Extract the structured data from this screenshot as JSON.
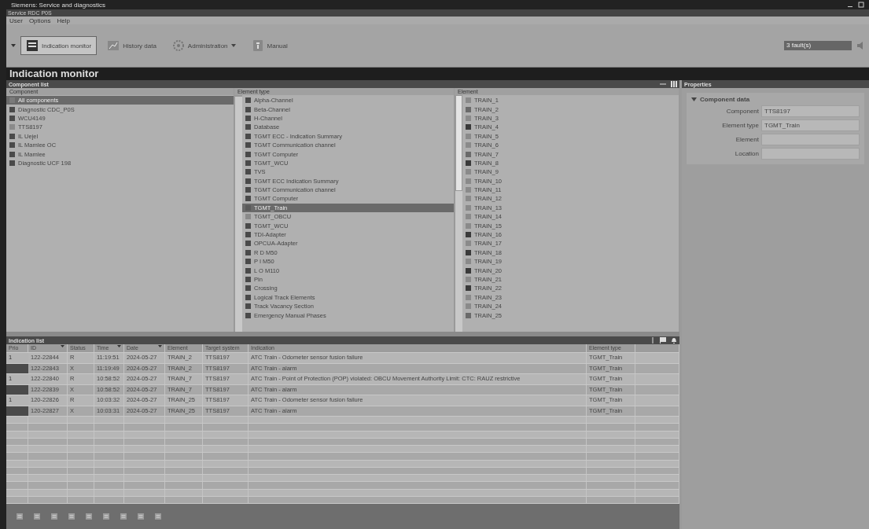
{
  "window": {
    "title": "Siemens: Service and diagnostics",
    "subtitle": "Service RDC P0S"
  },
  "menu": [
    "User",
    "Options",
    "Help"
  ],
  "toolbar": [
    {
      "label": "Indication monitor",
      "selected": true,
      "kind": "monitor"
    },
    {
      "label": "History data",
      "selected": false,
      "kind": "history"
    },
    {
      "label": "Administration",
      "selected": false,
      "kind": "admin"
    },
    {
      "label": "Manual",
      "selected": false,
      "kind": "manual"
    }
  ],
  "fault_counter": "3 fault(s)",
  "page_title": "Indication monitor",
  "component_panel": {
    "title": "Component list",
    "components": {
      "heading": "Component",
      "items": [
        {
          "label": "All components",
          "selected": true,
          "color": "#7a7a7a"
        },
        {
          "label": "Diagnostic CDC_P0S",
          "selected": false,
          "color": "#4a4a4a"
        },
        {
          "label": "WCU4149",
          "selected": false,
          "color": "#4a4a4a"
        },
        {
          "label": "TTS8197",
          "selected": false,
          "color": "#8a8a8a"
        },
        {
          "label": "IL Uejel",
          "selected": false,
          "color": "#4a4a4a"
        },
        {
          "label": "IL Mamlee OC",
          "selected": false,
          "color": "#4a4a4a"
        },
        {
          "label": "IL Mamlee",
          "selected": false,
          "color": "#4a4a4a"
        },
        {
          "label": "Diagnostic UCF 198",
          "selected": false,
          "color": "#4a4a4a"
        }
      ]
    },
    "element_types": {
      "heading": "Element type",
      "items": [
        {
          "label": "Alpha-Channel",
          "selected": false,
          "color": "#4a4a4a"
        },
        {
          "label": "Beta-Channel",
          "selected": false,
          "color": "#4a4a4a"
        },
        {
          "label": "H-Channel",
          "selected": false,
          "color": "#4a4a4a"
        },
        {
          "label": "Database",
          "selected": false,
          "color": "#4a4a4a"
        },
        {
          "label": "TGMT ECC - Indication Summary",
          "selected": false,
          "color": "#4a4a4a"
        },
        {
          "label": "TGMT Communication channel",
          "selected": false,
          "color": "#4a4a4a"
        },
        {
          "label": "TGMT Computer",
          "selected": false,
          "color": "#4a4a4a"
        },
        {
          "label": "TGMT_WCU",
          "selected": false,
          "color": "#4a4a4a"
        },
        {
          "label": "TVS",
          "selected": false,
          "color": "#4a4a4a"
        },
        {
          "label": "TGMT ECC Indication Summary",
          "selected": false,
          "color": "#4a4a4a"
        },
        {
          "label": "TGMT Communication channel",
          "selected": false,
          "color": "#4a4a4a"
        },
        {
          "label": "TGMT Computer",
          "selected": false,
          "color": "#4a4a4a"
        },
        {
          "label": "TGMT_Train",
          "selected": true,
          "color": "#5a5a5a"
        },
        {
          "label": "TGMT_OBCU",
          "selected": false,
          "color": "#8a8a8a"
        },
        {
          "label": "TGMT_WCU",
          "selected": false,
          "color": "#4a4a4a"
        },
        {
          "label": "TDI-Adapter",
          "selected": false,
          "color": "#4a4a4a"
        },
        {
          "label": "OPCUA-Adapter",
          "selected": false,
          "color": "#4a4a4a"
        },
        {
          "label": "R D M50",
          "selected": false,
          "color": "#4a4a4a"
        },
        {
          "label": "P I M50",
          "selected": false,
          "color": "#4a4a4a"
        },
        {
          "label": "L O M110",
          "selected": false,
          "color": "#4a4a4a"
        },
        {
          "label": "Pin",
          "selected": false,
          "color": "#4a4a4a"
        },
        {
          "label": "Crossing",
          "selected": false,
          "color": "#4a4a4a"
        },
        {
          "label": "Logical Track Elements",
          "selected": false,
          "color": "#4a4a4a"
        },
        {
          "label": "Track Vacancy Section",
          "selected": false,
          "color": "#4a4a4a"
        },
        {
          "label": "Emergency Manual Phases",
          "selected": false,
          "color": "#4a4a4a"
        }
      ]
    },
    "elements": {
      "heading": "Element",
      "items": [
        {
          "label": "TRAIN_1",
          "color": "#8a8a8a"
        },
        {
          "label": "TRAIN_2",
          "color": "#6a6a6a"
        },
        {
          "label": "TRAIN_3",
          "color": "#8a8a8a"
        },
        {
          "label": "TRAIN_4",
          "color": "#3a3a3a"
        },
        {
          "label": "TRAIN_5",
          "color": "#8a8a8a"
        },
        {
          "label": "TRAIN_6",
          "color": "#8a8a8a"
        },
        {
          "label": "TRAIN_7",
          "color": "#6a6a6a"
        },
        {
          "label": "TRAIN_8",
          "color": "#3a3a3a"
        },
        {
          "label": "TRAIN_9",
          "color": "#8a8a8a"
        },
        {
          "label": "TRAIN_10",
          "color": "#8a8a8a"
        },
        {
          "label": "TRAIN_11",
          "color": "#8a8a8a"
        },
        {
          "label": "TRAIN_12",
          "color": "#8a8a8a"
        },
        {
          "label": "TRAIN_13",
          "color": "#8a8a8a"
        },
        {
          "label": "TRAIN_14",
          "color": "#8a8a8a"
        },
        {
          "label": "TRAIN_15",
          "color": "#8a8a8a"
        },
        {
          "label": "TRAIN_16",
          "color": "#3a3a3a"
        },
        {
          "label": "TRAIN_17",
          "color": "#8a8a8a"
        },
        {
          "label": "TRAIN_18",
          "color": "#3a3a3a"
        },
        {
          "label": "TRAIN_19",
          "color": "#8a8a8a"
        },
        {
          "label": "TRAIN_20",
          "color": "#3a3a3a"
        },
        {
          "label": "TRAIN_21",
          "color": "#8a8a8a"
        },
        {
          "label": "TRAIN_22",
          "color": "#3a3a3a"
        },
        {
          "label": "TRAIN_23",
          "color": "#8a8a8a"
        },
        {
          "label": "TRAIN_24",
          "color": "#8a8a8a"
        },
        {
          "label": "TRAIN_25",
          "color": "#6a6a6a"
        }
      ]
    }
  },
  "properties": {
    "title": "Properties",
    "section": "Component data",
    "expanded": true,
    "fields": [
      {
        "label": "Component",
        "value": "TTS8197"
      },
      {
        "label": "Element type",
        "value": "TGMT_Train"
      },
      {
        "label": "Element"
      },
      {
        "label": "Location"
      }
    ]
  },
  "indication_list": {
    "title": "Indication list",
    "columns": [
      {
        "label": "Prio",
        "sortable": false
      },
      {
        "label": "ID",
        "sortable": true
      },
      {
        "label": "Status",
        "sortable": false
      },
      {
        "label": "Time",
        "sortable": true
      },
      {
        "label": "Date",
        "sortable": true
      },
      {
        "label": "Element",
        "sortable": false
      },
      {
        "label": "Target system",
        "sortable": false
      },
      {
        "label": "Indication",
        "sortable": false
      },
      {
        "label": "Element type",
        "sortable": false
      }
    ],
    "rows": [
      {
        "color": "#b4b4b4",
        "cells": [
          "1",
          "122-22844",
          "R",
          "11:19:51",
          "2024-05-27",
          "TRAIN_2",
          "TTS8197",
          "ATC Train - Odometer sensor fusion failure",
          "TGMT_Train"
        ]
      },
      {
        "color": "#4a4a4a",
        "cells": [
          "",
          "122-22843",
          "X",
          "11:19:49",
          "2024-05-27",
          "TRAIN_2",
          "TTS8197",
          "ATC Train - alarm",
          "TGMT_Train"
        ]
      },
      {
        "color": "#b4b4b4",
        "cells": [
          "1",
          "122-22840",
          "R",
          "10:58:52",
          "2024-05-27",
          "TRAIN_7",
          "TTS8197",
          "ATC Train - Point of Protection (POP) violated: OBCU Movement Authority Limit: CTC: RAUZ restrictive",
          "TGMT_Train"
        ]
      },
      {
        "color": "#4a4a4a",
        "cells": [
          "",
          "122-22839",
          "X",
          "10:58:52",
          "2024-05-27",
          "TRAIN_7",
          "TTS8197",
          "ATC Train - alarm",
          "TGMT_Train"
        ]
      },
      {
        "color": "#b4b4b4",
        "cells": [
          "1",
          "120-22826",
          "R",
          "10:03:32",
          "2024-05-27",
          "TRAIN_25",
          "TTS8197",
          "ATC Train - Odometer sensor fusion failure",
          "TGMT_Train"
        ]
      },
      {
        "color": "#4a4a4a",
        "cells": [
          "",
          "120-22827",
          "X",
          "10:03:31",
          "2024-05-27",
          "TRAIN_25",
          "TTS8197",
          "ATC Train - alarm",
          "TGMT_Train"
        ]
      }
    ]
  }
}
